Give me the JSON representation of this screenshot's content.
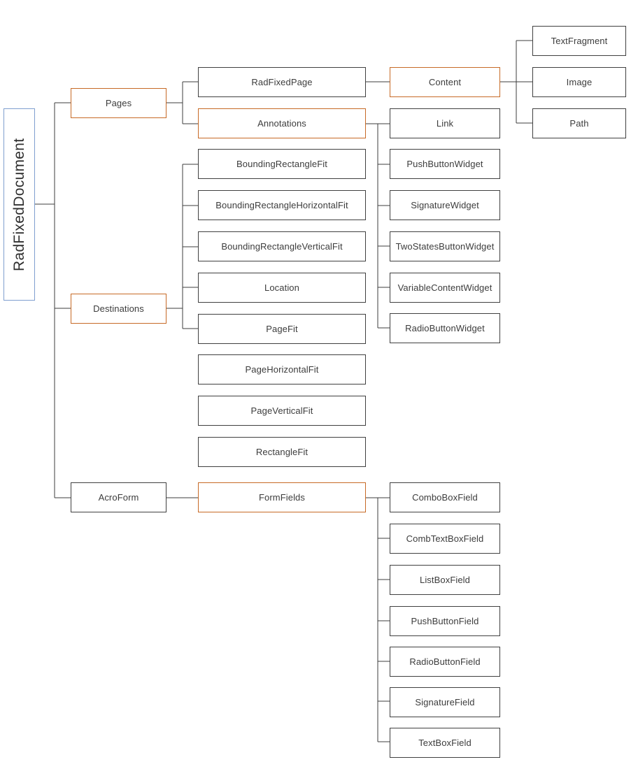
{
  "diagram": {
    "title": "RadFixedDocument",
    "colors": {
      "orange_border": "#c76a26",
      "blue_border": "#7f9fcf",
      "dark_border": "#404040",
      "text": "#3c3c3c",
      "background": "#ffffff"
    },
    "root": {
      "label": "RadFixedDocument",
      "accent": "blue"
    },
    "level1": [
      {
        "label": "Pages",
        "accent": "orange"
      },
      {
        "label": "Destinations",
        "accent": "orange"
      },
      {
        "label": "AcroForm",
        "accent": "dark"
      }
    ],
    "pages_children": [
      {
        "label": "RadFixedPage",
        "accent": "dark"
      },
      {
        "label": "Annotations",
        "accent": "orange"
      }
    ],
    "radfixedpage_children": [
      {
        "label": "Content",
        "accent": "orange"
      }
    ],
    "content_children": [
      {
        "label": "TextFragment",
        "accent": "dark"
      },
      {
        "label": "Image",
        "accent": "dark"
      },
      {
        "label": "Path",
        "accent": "dark"
      }
    ],
    "annotations_children": [
      {
        "label": "Link",
        "accent": "dark"
      },
      {
        "label": "PushButtonWidget",
        "accent": "dark"
      },
      {
        "label": "SignatureWidget",
        "accent": "dark"
      },
      {
        "label": "TwoStatesButtonWidget",
        "accent": "dark"
      },
      {
        "label": "VariableContentWidget",
        "accent": "dark"
      },
      {
        "label": "RadioButtonWidget",
        "accent": "dark"
      }
    ],
    "destinations_children": [
      {
        "label": "BoundingRectangleFit",
        "accent": "dark"
      },
      {
        "label": "BoundingRectangleHorizontalFit",
        "accent": "dark"
      },
      {
        "label": "BoundingRectangleVerticalFit",
        "accent": "dark"
      },
      {
        "label": "Location",
        "accent": "dark"
      },
      {
        "label": "PageFit",
        "accent": "dark"
      },
      {
        "label": "PageHorizontalFit",
        "accent": "dark"
      },
      {
        "label": "PageVerticalFit",
        "accent": "dark"
      },
      {
        "label": "RectangleFit",
        "accent": "dark"
      }
    ],
    "acroform_children": [
      {
        "label": "FormFields",
        "accent": "orange"
      }
    ],
    "formfields_children": [
      {
        "label": "ComboBoxField",
        "accent": "dark"
      },
      {
        "label": "CombTextBoxField",
        "accent": "dark"
      },
      {
        "label": "ListBoxField",
        "accent": "dark"
      },
      {
        "label": "PushButtonField",
        "accent": "dark"
      },
      {
        "label": "RadioButtonField",
        "accent": "dark"
      },
      {
        "label": "SignatureField",
        "accent": "dark"
      },
      {
        "label": "TextBoxField",
        "accent": "dark"
      }
    ]
  }
}
